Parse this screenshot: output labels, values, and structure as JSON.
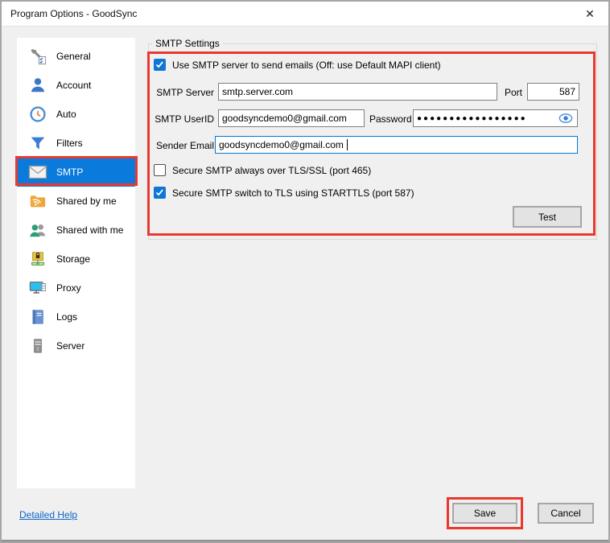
{
  "window": {
    "title": "Program Options - GoodSync",
    "close_icon": "✕"
  },
  "sidebar": {
    "items": [
      {
        "label": "General"
      },
      {
        "label": "Account"
      },
      {
        "label": "Auto"
      },
      {
        "label": "Filters"
      },
      {
        "label": "SMTP",
        "selected": true
      },
      {
        "label": "Shared by me"
      },
      {
        "label": "Shared with me"
      },
      {
        "label": "Storage"
      },
      {
        "label": "Proxy"
      },
      {
        "label": "Logs"
      },
      {
        "label": "Server"
      }
    ]
  },
  "smtp_panel": {
    "group_title": "SMTP Settings",
    "use_smtp": {
      "label": "Use SMTP server to send emails (Off: use Default MAPI client)",
      "checked": true
    },
    "smtp_server": {
      "label": "SMTP Server",
      "value": "smtp.server.com"
    },
    "port": {
      "label": "Port",
      "value": "587"
    },
    "smtp_userid": {
      "label": "SMTP UserID",
      "value": "goodsyncdemo0@gmail.com"
    },
    "password": {
      "label": "Password",
      "value": "●●●●●●●●●●●●●●●●●",
      "masked": true
    },
    "sender_email": {
      "label": "Sender Email",
      "value": "goodsyncdemo0@gmail.com",
      "focused": true
    },
    "secure_ssl": {
      "label": "Secure SMTP always over TLS/SSL (port 465)",
      "checked": false
    },
    "secure_starttls": {
      "label": "Secure SMTP switch to TLS using STARTTLS (port 587)",
      "checked": true
    },
    "test_button": "Test"
  },
  "footer": {
    "help_link": "Detailed Help",
    "save_button": "Save",
    "cancel_button": "Cancel"
  },
  "colors": {
    "selected_item_blue": "#0a7bdc",
    "annotation_red": "#e9392f",
    "checkbox_blue": "#1076d6",
    "link_blue": "#0b63c5",
    "focus_border_blue": "#0078d7"
  }
}
